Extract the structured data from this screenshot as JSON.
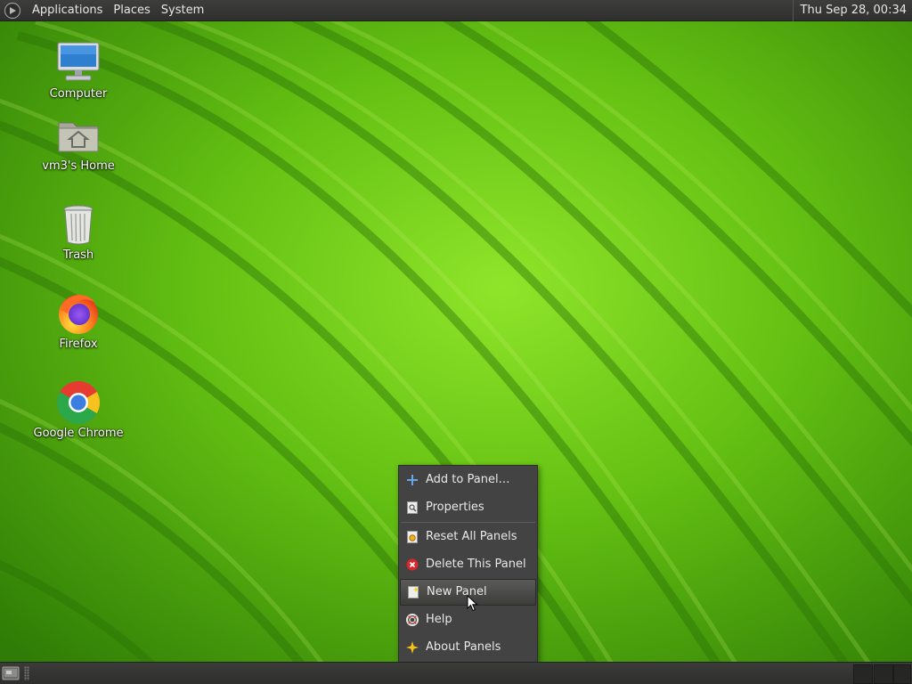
{
  "top_panel": {
    "menus": [
      "Applications",
      "Places",
      "System"
    ],
    "clock": "Thu Sep 28, 00:34",
    "logo_icon": "mate-logo-icon"
  },
  "desktop_icons": [
    {
      "label": "Computer",
      "icon": "computer-icon"
    },
    {
      "label": "vm3's Home",
      "icon": "home-folder-icon"
    },
    {
      "label": "Trash",
      "icon": "trash-icon"
    },
    {
      "label": "Firefox",
      "icon": "firefox-icon"
    },
    {
      "label": "Google Chrome",
      "icon": "chrome-icon"
    }
  ],
  "context_menu": {
    "items": [
      {
        "label": "Add to Panel…",
        "icon": "add-icon"
      },
      {
        "label": "Properties",
        "icon": "properties-icon"
      },
      {
        "label": "Reset All Panels",
        "icon": "reset-icon"
      },
      {
        "label": "Delete This Panel",
        "icon": "delete-icon"
      },
      {
        "label": "New Panel",
        "icon": "new-panel-icon",
        "highlighted": true
      },
      {
        "label": "Help",
        "icon": "help-icon"
      },
      {
        "label": "About Panels",
        "icon": "about-icon"
      }
    ]
  },
  "bottom_panel": {
    "show_desktop_icon": "show-desktop-icon",
    "workspaces_shown": 3
  },
  "colors": {
    "wallpaper_green": "#5cb30e",
    "panel_bg": "#3a3b39",
    "menu_bg": "#424342",
    "menu_text": "#e8e8e8"
  }
}
